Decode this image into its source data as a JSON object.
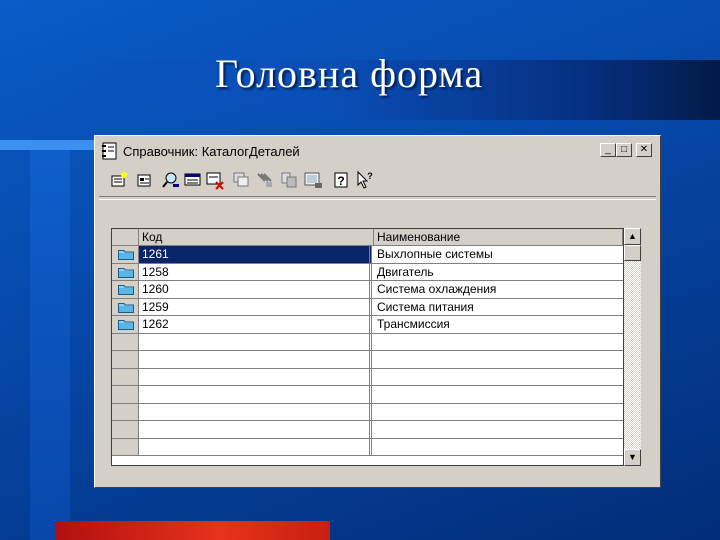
{
  "slide": {
    "title": "Головна форма"
  },
  "window": {
    "title": "Справочник: КаталогДеталей",
    "controls": {
      "minimize": "_",
      "maximize": "□",
      "close": "✕"
    }
  },
  "toolbar": {
    "icons": [
      "new-item-icon",
      "new-folder-icon",
      "find-icon",
      "edit-icon",
      "delete-icon",
      "copy-icon",
      "move-icon",
      "hierarchy-icon",
      "filter-icon",
      "help-icon",
      "whats-this-icon"
    ]
  },
  "table": {
    "columns": [
      "Код",
      "Наименование"
    ],
    "rows": [
      {
        "code": "1261",
        "name": "Выхлопные системы"
      },
      {
        "code": "1258",
        "name": "Двигатель"
      },
      {
        "code": "1260",
        "name": "Система охлаждения"
      },
      {
        "code": "1259",
        "name": "Система питания"
      },
      {
        "code": "1262",
        "name": "Трансмиссия"
      }
    ],
    "selected_row": 0
  },
  "scrollbar": {
    "up": "▲",
    "down": "▼"
  },
  "colors": {
    "selection": "#0a246a",
    "window": "#d4d0c8",
    "accent_red": "#e8321c"
  }
}
